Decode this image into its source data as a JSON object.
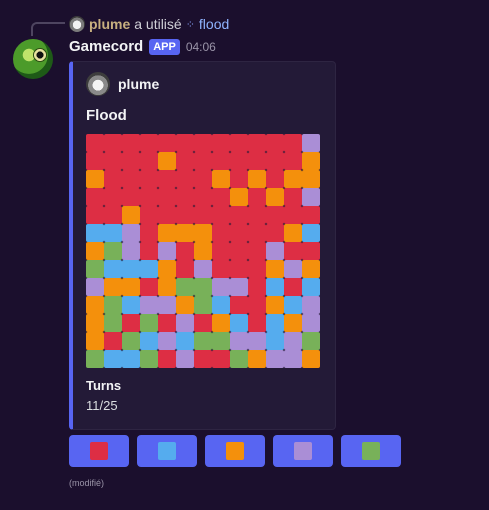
{
  "reply": {
    "user": "plume",
    "verb": "a utilisé",
    "command": "flood",
    "command_icon": "slash-command-icon"
  },
  "message": {
    "bot_name": "Gamecord",
    "tag": "APP",
    "time": "04:06",
    "edited": "(modifié)"
  },
  "embed": {
    "accent_color": "#5865f2",
    "author": "plume",
    "title": "Flood",
    "field_name": "Turns",
    "field_value": "11/25",
    "board": [
      [
        "red",
        "red",
        "red",
        "red",
        "red",
        "red",
        "red",
        "red",
        "red",
        "red",
        "red",
        "red",
        "purple"
      ],
      [
        "red",
        "red",
        "red",
        "red",
        "orange",
        "red",
        "red",
        "red",
        "red",
        "red",
        "red",
        "red",
        "orange"
      ],
      [
        "orange",
        "red",
        "red",
        "red",
        "red",
        "red",
        "red",
        "orange",
        "red",
        "orange",
        "red",
        "orange",
        "orange"
      ],
      [
        "red",
        "red",
        "red",
        "red",
        "red",
        "red",
        "red",
        "red",
        "orange",
        "red",
        "orange",
        "red",
        "purple"
      ],
      [
        "red",
        "red",
        "orange",
        "red",
        "red",
        "red",
        "red",
        "red",
        "red",
        "red",
        "red",
        "red",
        "red"
      ],
      [
        "blue",
        "blue",
        "purple",
        "red",
        "orange",
        "orange",
        "orange",
        "red",
        "red",
        "red",
        "red",
        "orange",
        "blue"
      ],
      [
        "orange",
        "green",
        "purple",
        "red",
        "purple",
        "red",
        "orange",
        "red",
        "red",
        "red",
        "purple",
        "red",
        "red"
      ],
      [
        "green",
        "blue",
        "blue",
        "blue",
        "orange",
        "red",
        "purple",
        "red",
        "red",
        "red",
        "orange",
        "purple",
        "orange"
      ],
      [
        "purple",
        "orange",
        "orange",
        "red",
        "orange",
        "green",
        "green",
        "purple",
        "purple",
        "red",
        "blue",
        "red",
        "blue"
      ],
      [
        "orange",
        "green",
        "blue",
        "purple",
        "purple",
        "orange",
        "green",
        "blue",
        "red",
        "red",
        "orange",
        "blue",
        "purple"
      ],
      [
        "orange",
        "green",
        "red",
        "green",
        "red",
        "purple",
        "red",
        "orange",
        "blue",
        "red",
        "blue",
        "orange",
        "purple"
      ],
      [
        "orange",
        "red",
        "green",
        "blue",
        "purple",
        "blue",
        "green",
        "green",
        "purple",
        "purple",
        "blue",
        "purple",
        "green"
      ],
      [
        "green",
        "blue",
        "blue",
        "green",
        "red",
        "purple",
        "red",
        "red",
        "green",
        "orange",
        "purple",
        "purple",
        "orange"
      ]
    ]
  },
  "colors": {
    "red": "#dd2e44",
    "blue": "#55acee",
    "orange": "#f4900c",
    "purple": "#aa8ed6",
    "green": "#78b159"
  },
  "buttons": [
    {
      "name": "red-color-button",
      "color": "red"
    },
    {
      "name": "blue-color-button",
      "color": "blue"
    },
    {
      "name": "orange-color-button",
      "color": "orange"
    },
    {
      "name": "purple-color-button",
      "color": "purple"
    },
    {
      "name": "green-color-button",
      "color": "green"
    }
  ]
}
